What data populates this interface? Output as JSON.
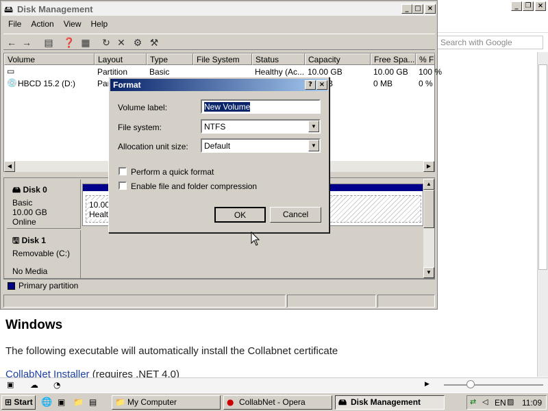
{
  "opera": {
    "search_placeholder": "Search with Google",
    "heading": "Windows",
    "paragraph": "The following executable will automatically install the Collabnet certificate",
    "link_text": "CollabNet Installer",
    "link_suffix": " (requires .NET 4.0)"
  },
  "disk_management": {
    "title": "Disk Management",
    "menu": [
      "File",
      "Action",
      "View",
      "Help"
    ],
    "columns": [
      "Volume",
      "Layout",
      "Type",
      "File System",
      "Status",
      "Capacity",
      "Free Spa...",
      "% Fr"
    ],
    "rows": [
      {
        "volume": "",
        "layout": "Partition",
        "type": "Basic",
        "fs": "",
        "status": "Healthy (Ac...",
        "capacity": "10.00 GB",
        "free": "10.00 GB",
        "pct": "100 %"
      },
      {
        "volume": "HBCD 15.2 (D:)",
        "layout": "Par",
        "type": "",
        "fs": "",
        "status": "",
        "capacity": "B",
        "free": "0 MB",
        "pct": "0 %"
      }
    ],
    "disks": [
      {
        "name": "Disk 0",
        "type": "Basic",
        "size": "10.00 GB",
        "state": "Online",
        "part_size": "10.00",
        "part_status": "Health"
      },
      {
        "name": "Disk 1",
        "type": "Removable (C:)",
        "state": "No Media"
      }
    ],
    "legend": "Primary partition",
    "colors": {
      "partition_bar": "#00008b",
      "legend_swatch": "#000080"
    }
  },
  "format_dialog": {
    "title": "Format",
    "help_btn": "?",
    "close_btn": "×",
    "volume_label_lbl": "Volume label:",
    "volume_label_val": "New Volume",
    "file_system_lbl": "File system:",
    "file_system_val": "NTFS",
    "alloc_lbl": "Allocation unit size:",
    "alloc_val": "Default",
    "quick_format": "Perform a quick format",
    "compression": "Enable file and folder compression",
    "ok": "OK",
    "cancel": "Cancel"
  },
  "taskbar": {
    "start": "Start",
    "tasks": [
      "My Computer",
      "CollabNet - Opera",
      "Disk Management"
    ],
    "lang": "EN",
    "clock": "11:09"
  }
}
